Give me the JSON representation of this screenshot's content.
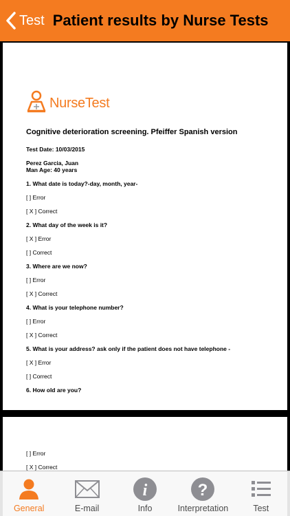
{
  "nav": {
    "back_label": "Test",
    "title": "Patient results by Nurse Tests"
  },
  "document": {
    "logo_text": "NurseTest",
    "title": "Cognitive deterioration screening. Pfeiffer Spanish version",
    "test_date": "Test Date: 10/03/2015",
    "patient_name": "Perez Garcia, Juan",
    "patient_info": "Man   Age: 40 years",
    "questions": [
      {
        "question": "1. What date is today?-day, month, year-",
        "answers": [
          "[    ] Error",
          "[ X ] Correct"
        ]
      },
      {
        "question": "2. What day of the week is it?",
        "answers": [
          "[ X ] Error",
          "[    ] Correct"
        ]
      },
      {
        "question": "3. Where are we now?",
        "answers": [
          "[    ] Error",
          "[ X ] Correct"
        ]
      },
      {
        "question": "4. What is your telephone number?",
        "answers": [
          "[    ] Error",
          "[ X ] Correct"
        ]
      },
      {
        "question": "5. What is your address? ask only if the patient does not have telephone -",
        "answers": [
          "[ X ] Error",
          "[    ] Correct"
        ]
      },
      {
        "question": "6. How old are you?",
        "answers": []
      }
    ],
    "page2_answers": [
      "[    ] Error",
      "[ X ] Correct"
    ]
  },
  "tabbar": {
    "tabs": [
      {
        "label": "General",
        "icon": "person-icon",
        "active": true
      },
      {
        "label": "E-mail",
        "icon": "envelope-icon",
        "active": false
      },
      {
        "label": "Info",
        "icon": "info-icon",
        "active": false
      },
      {
        "label": "Interpretation",
        "icon": "question-icon",
        "active": false
      },
      {
        "label": "Test",
        "icon": "list-icon",
        "active": false
      }
    ]
  },
  "colors": {
    "accent": "#f47b20",
    "tab_icon_gray": "#8e8e93"
  }
}
